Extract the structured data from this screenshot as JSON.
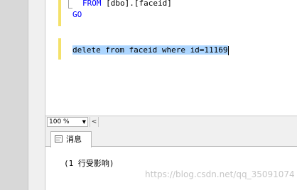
{
  "editor": {
    "lines": [
      {
        "keyword": "FROM",
        "text": " [dbo].[faceid]"
      },
      {
        "keyword": "GO",
        "text": ""
      },
      {
        "selected_text": "delete from faceid where id=11169"
      }
    ]
  },
  "zoom": {
    "value": "100 %",
    "scroll_left_glyph": "<"
  },
  "results": {
    "tab_label": "消息",
    "message": "(1 行受影响)"
  },
  "watermark": "https://blog.csdn.net/qq_35091074",
  "colors": {
    "keyword": "#0000ff",
    "selection": "#add6ff",
    "change_bar": "#f4e16a"
  }
}
